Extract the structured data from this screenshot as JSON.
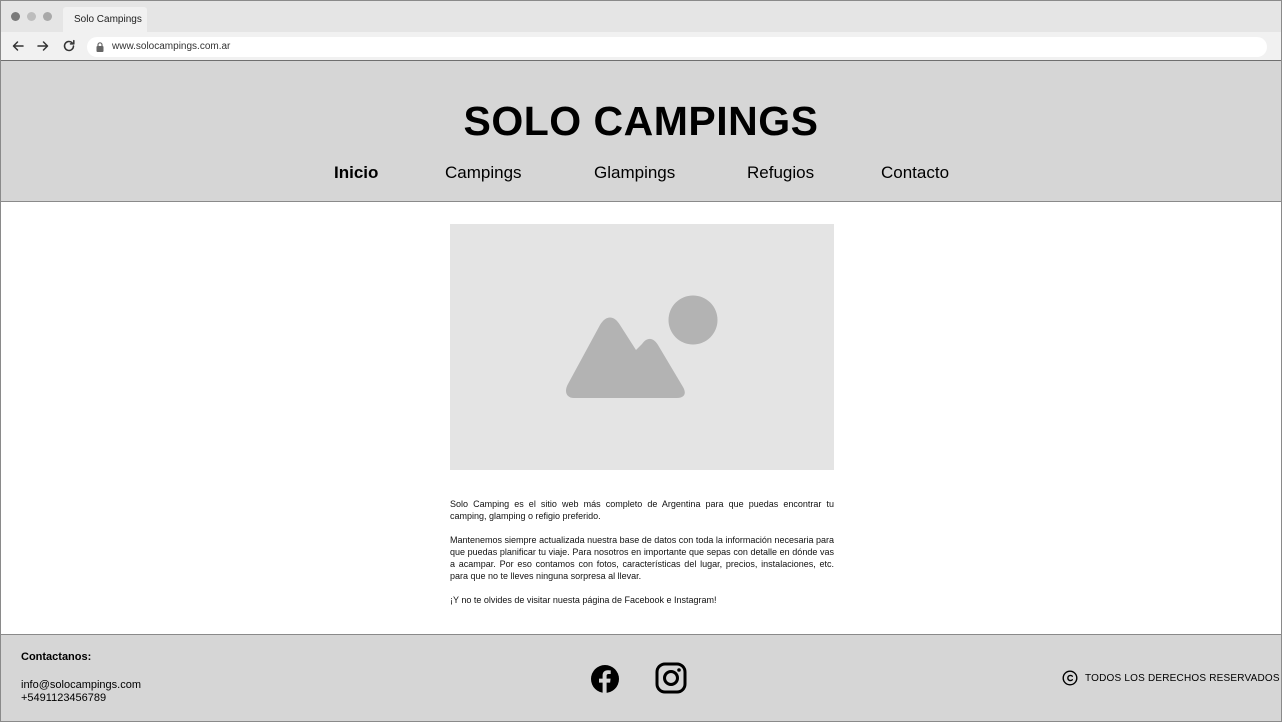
{
  "browser": {
    "tab_title": "Solo Campings",
    "url": "www.solocampings.com.ar",
    "icons": [
      "back-arrow-icon",
      "forward-arrow-icon",
      "reload-icon",
      "lock-icon"
    ]
  },
  "header": {
    "site_title": "SOLO CAMPINGS",
    "nav": [
      {
        "label": "Inicio",
        "active": true
      },
      {
        "label": "Campings",
        "active": false
      },
      {
        "label": "Glampings",
        "active": false
      },
      {
        "label": "Refugios",
        "active": false
      },
      {
        "label": "Contacto",
        "active": false
      }
    ]
  },
  "main": {
    "image_placeholder": "image-placeholder-icon",
    "paragraphs": [
      "Solo Camping es el sitio web más completo de Argentina para que puedas encontrar tu camping, glamping o refigio preferido.",
      "Mantenemos siempre actualizada nuestra base de datos con toda la información necesaria para que puedas planificar tu viaje. Para nosotros en importante que sepas con detalle en dónde vas a acampar. Por eso contamos con fotos, características del lugar, precios, instalaciones, etc. para que no te lleves ninguna sorpresa al llevar.",
      "¡Y no te olvides de visitar nuesta página de Facebook e Instagram!"
    ]
  },
  "footer": {
    "contact_title": "Contactanos:",
    "email": "info@solocampings.com",
    "phone": "+5491123456789",
    "social": [
      "facebook-icon",
      "instagram-icon"
    ],
    "rights": "TODOS LOS DERECHOS RESERVADOS"
  },
  "colors": {
    "header_bg": "#d6d6d6",
    "footer_bg": "#d6d6d6",
    "placeholder_bg": "#e4e4e4",
    "placeholder_fg": "#b3b3b3"
  }
}
